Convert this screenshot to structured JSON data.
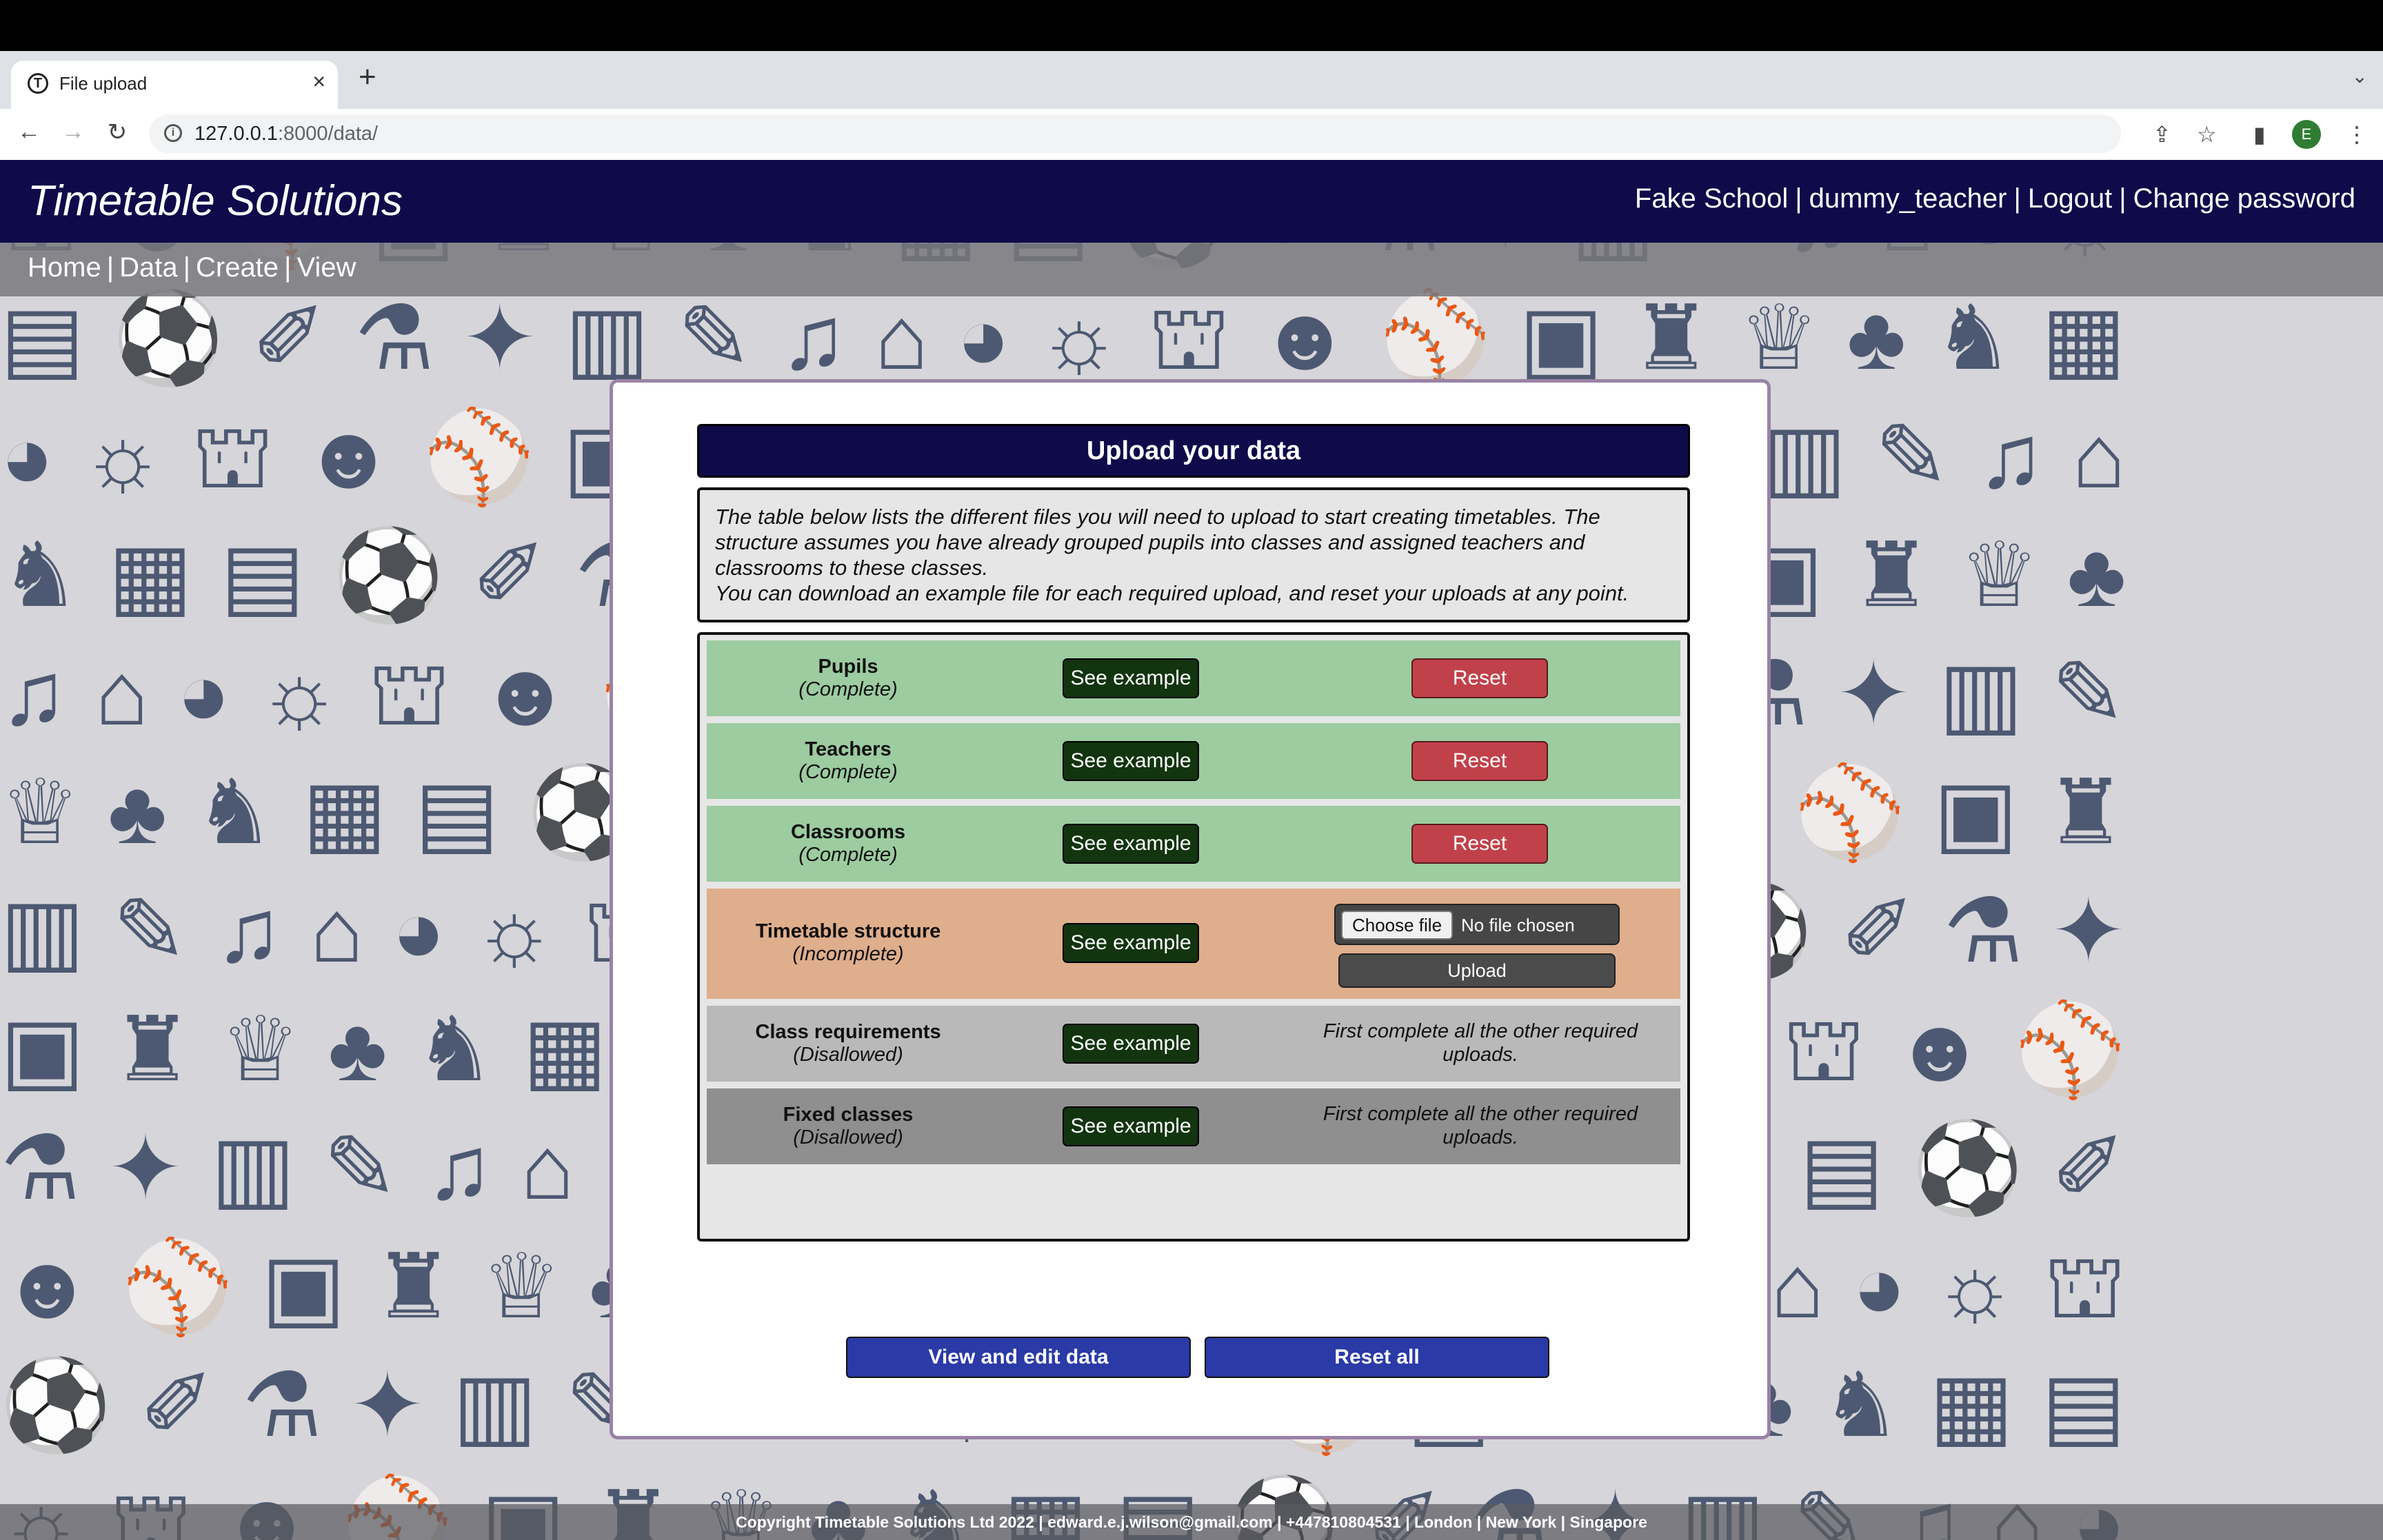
{
  "browser": {
    "tab_title": "File upload",
    "tab_close": "×",
    "new_tab": "+",
    "tab_menu": "⌄",
    "url_host": "127.0.0.1",
    "url_rest": ":8000/data/",
    "back": "←",
    "forward": "→",
    "reload": "↻",
    "share": "⇪",
    "bookmark": "☆",
    "sidepanel": "▮",
    "menu": "⋮",
    "profile_initial": "E",
    "icons": [
      "favicon-icon",
      "info-icon",
      "share-icon",
      "star-icon",
      "side-panel-icon",
      "kebab-menu-icon"
    ]
  },
  "header": {
    "brand": "Timetable Solutions",
    "school": "Fake School",
    "user": "dummy_teacher",
    "logout": "Logout",
    "change_password": "Change password",
    "separator": "|"
  },
  "nav": {
    "home": "Home",
    "data": "Data",
    "create": "Create",
    "view": "View",
    "separator": "|"
  },
  "upload": {
    "title": "Upload your data",
    "intro_line1": "The table below lists the different files you will need to upload to start creating timetables. The structure assumes you have already grouped pupils into classes and assigned teachers and classrooms to these classes.",
    "intro_line2": "You can download an example file for each required upload, and reset your uploads at any point.",
    "see_example": "See example",
    "reset": "Reset",
    "choose_file": "Choose file",
    "no_file": "No file chosen",
    "upload_button": "Upload",
    "disallowed_message": "First complete all the other required uploads.",
    "rows": [
      {
        "name": "Pupils",
        "status": "(Complete)",
        "color": "#9ccca0"
      },
      {
        "name": "Teachers",
        "status": "(Complete)",
        "color": "#9ccca0"
      },
      {
        "name": "Classrooms",
        "status": "(Complete)",
        "color": "#9ccca0"
      },
      {
        "name": "Timetable structure",
        "status": "(Incomplete)",
        "color": "#dfae8c"
      },
      {
        "name": "Class requirements",
        "status": "(Disallowed)",
        "color": "#b9b9b9"
      },
      {
        "name": "Fixed classes",
        "status": "(Disallowed)",
        "color": "#8f8f8f"
      }
    ],
    "view_edit": "View and edit data",
    "reset_all": "Reset all"
  },
  "footer": {
    "text": "Copyright Timetable Solutions Ltd 2022 | edward.e.j.wilson@gmail.com | +447810804531 | London | New York | Singapore"
  },
  "colors": {
    "header_bg": "#0f0a4a",
    "complete": "#9ccca0",
    "incomplete": "#dfae8c",
    "example_btn": "#12340f",
    "reset_btn": "#c1414a",
    "bottom_btn": "#2a3aa6",
    "pattern": "#46536d"
  }
}
